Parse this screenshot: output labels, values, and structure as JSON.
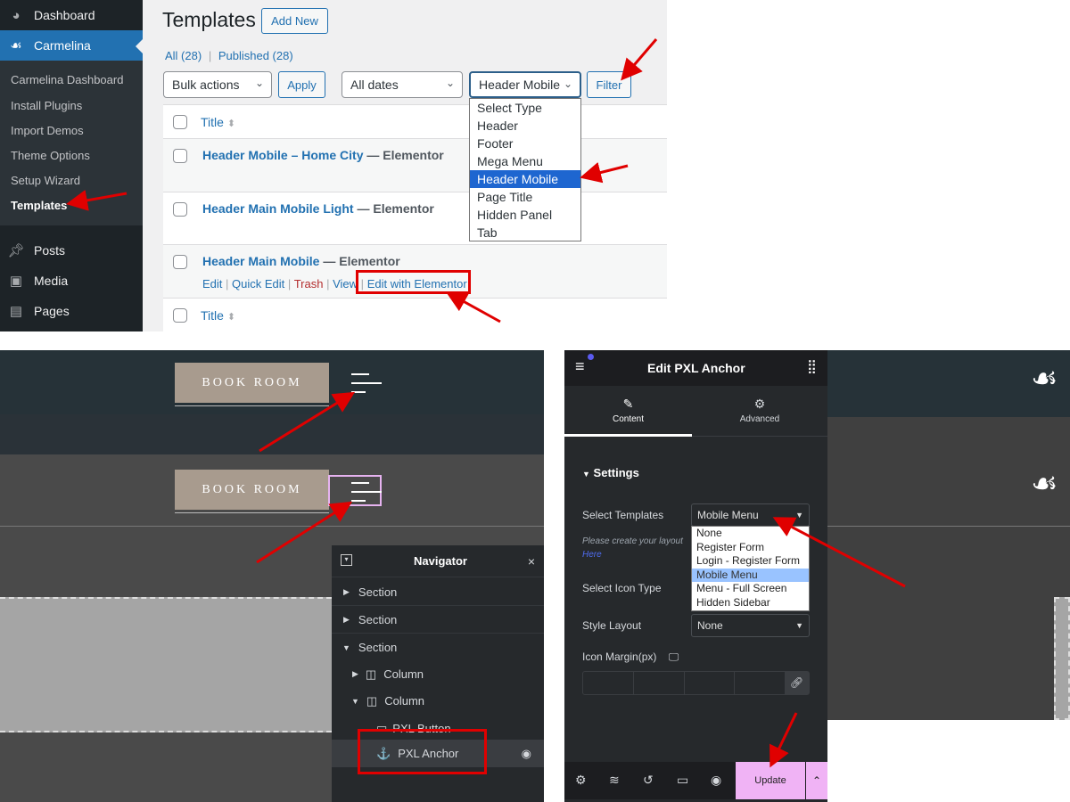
{
  "wp": {
    "sidebar": {
      "dashboard": "Dashboard",
      "carmelina": "Carmelina",
      "submenu": [
        "Carmelina Dashboard",
        "Install Plugins",
        "Import Demos",
        "Theme Options",
        "Setup Wizard",
        "Templates"
      ],
      "posts": "Posts",
      "media": "Media",
      "pages": "Pages"
    },
    "title": "Templates",
    "add_new": "Add New",
    "views": {
      "all": "All (28)",
      "sep": "|",
      "published": "Published (28)"
    },
    "bulk_actions": "Bulk actions",
    "apply": "Apply",
    "dates": "All dates",
    "type_filter": "Header Mobile",
    "filter": "Filter",
    "type_options": [
      "Select Type",
      "Header",
      "Footer",
      "Mega Menu",
      "Header Mobile",
      "Page Title",
      "Hidden Panel",
      "Tab"
    ],
    "column_title": "Title",
    "rows": [
      {
        "title": "Header Mobile – Home City",
        "suffix": " — Elementor"
      },
      {
        "title": "Header Main Mobile Light",
        "suffix": " — Elementor"
      },
      {
        "title": "Header Main Mobile",
        "suffix": " — Elementor"
      }
    ],
    "row_actions": {
      "edit": "Edit",
      "quick_edit": "Quick Edit",
      "trash": "Trash",
      "view": "View",
      "edit_elementor": "Edit with Elementor"
    }
  },
  "preview": {
    "book_room": "BOOK ROOM"
  },
  "navigator": {
    "title": "Navigator",
    "items": [
      "Section",
      "Section",
      "Section",
      "Column",
      "Column",
      "PXL Button",
      "PXL Anchor"
    ]
  },
  "elementor": {
    "title": "Edit PXL Anchor",
    "tab_content": "Content",
    "tab_advanced": "Advanced",
    "section": "Settings",
    "select_templates_label": "Select Templates",
    "select_templates_value": "Mobile Menu",
    "template_options": [
      "None",
      "Register Form",
      "Login - Register Form",
      "Mobile Menu",
      "Menu - Full Screen",
      "Hidden Sidebar"
    ],
    "help_text": "Please create your layout",
    "help_link": "Here",
    "icon_type_label": "Select Icon Type",
    "style_layout_label": "Style Layout",
    "style_layout_value": "None",
    "icon_margin_label": "Icon Margin(px)",
    "update": "Update"
  },
  "colors": {
    "wp_accent": "#2271b1",
    "annotation": "#e00000",
    "update_bg": "#f0b3f5"
  }
}
